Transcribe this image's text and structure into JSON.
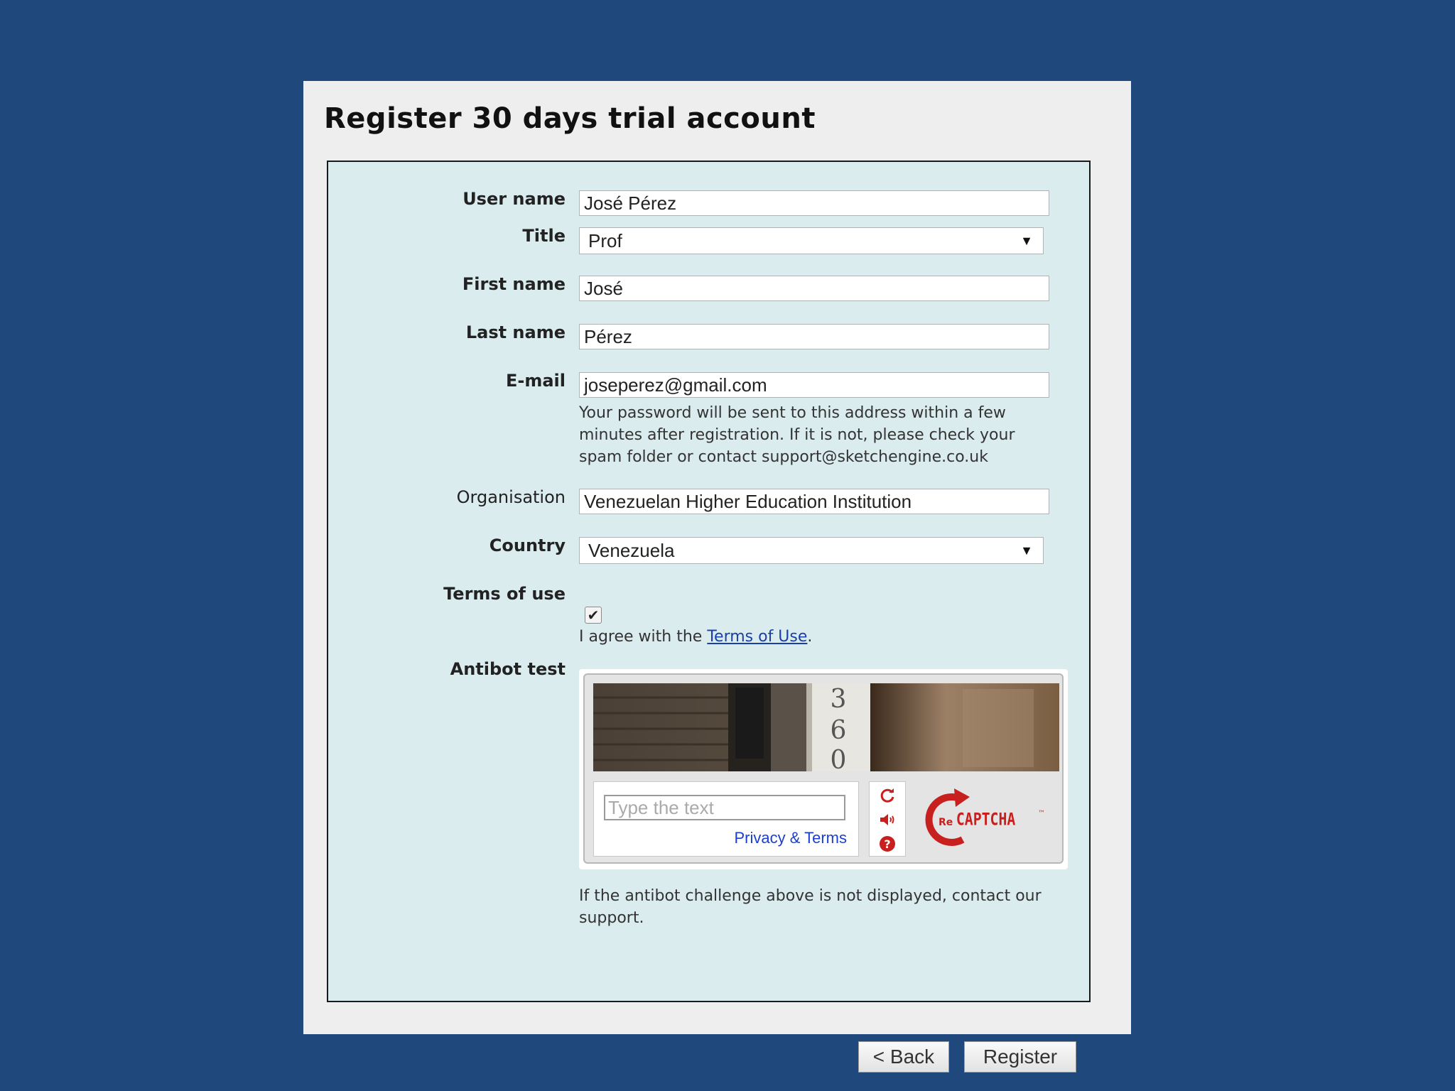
{
  "page": {
    "title": "Register 30 days trial account"
  },
  "form": {
    "username": {
      "label": "User name",
      "value": "José Pérez"
    },
    "title": {
      "label": "Title",
      "value": "Prof"
    },
    "firstname": {
      "label": "First name",
      "value": "José"
    },
    "lastname": {
      "label": "Last name",
      "value": "Pérez"
    },
    "email": {
      "label": "E-mail",
      "value": "joseperez@gmail.com",
      "help_line1": "Your password will be sent to this address within a few",
      "help_line2": "minutes after registration. If it is not, please check your",
      "help_line3": "spam folder or contact support@sketchengine.co.uk"
    },
    "organisation": {
      "label": "Organisation",
      "value": "Venezuelan Higher Education Institution"
    },
    "country": {
      "label": "Country",
      "value": "Venezuela"
    },
    "terms": {
      "label": "Terms of use",
      "checked": true,
      "check_glyph": "✔",
      "agree_prefix": "I agree with the ",
      "agree_link": "Terms of Use",
      "agree_suffix": "."
    },
    "antibot": {
      "label": "Antibot test",
      "captcha_digits": [
        "3",
        "6",
        "0"
      ],
      "placeholder": "Type the text",
      "privacy_link": "Privacy & Terms",
      "logo_text": "CAPTCHA",
      "logo_prefix": "Re",
      "logo_tm": "™",
      "note_line1": "If the antibot challenge above is not displayed, contact our",
      "note_line2": "support."
    },
    "buttons": {
      "back": "< Back",
      "register": "Register"
    }
  },
  "colors": {
    "background": "#1f497d",
    "form_bg": "#dbecef",
    "link": "#1a3fa8",
    "recaptcha_red": "#c8201e"
  }
}
